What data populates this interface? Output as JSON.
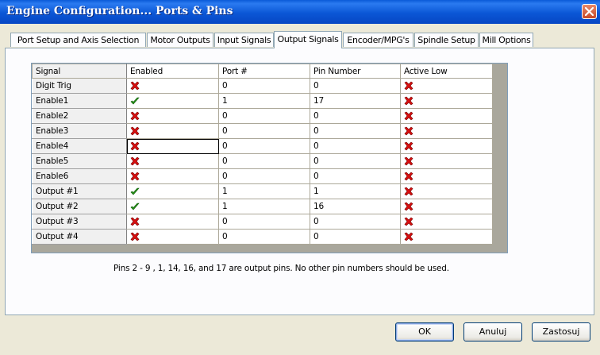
{
  "window": {
    "title": "Engine Configuration... Ports & Pins",
    "close_icon": "close-icon"
  },
  "tabs": [
    {
      "label": "Port Setup and Axis Selection",
      "active": false
    },
    {
      "label": "Motor Outputs",
      "active": false
    },
    {
      "label": "Input Signals",
      "active": false
    },
    {
      "label": "Output Signals",
      "active": true
    },
    {
      "label": "Encoder/MPG's",
      "active": false
    },
    {
      "label": "Spindle Setup",
      "active": false
    },
    {
      "label": "Mill Options",
      "active": false
    }
  ],
  "grid": {
    "columns": [
      "Signal",
      "Enabled",
      "Port #",
      "Pin Number",
      "Active Low"
    ],
    "rows": [
      {
        "signal": "Digit  Trig",
        "enabled": false,
        "port": "0",
        "pin": "0",
        "active_low": false
      },
      {
        "signal": "Enable1",
        "enabled": true,
        "port": "1",
        "pin": "17",
        "active_low": false
      },
      {
        "signal": "Enable2",
        "enabled": false,
        "port": "0",
        "pin": "0",
        "active_low": false
      },
      {
        "signal": "Enable3",
        "enabled": false,
        "port": "0",
        "pin": "0",
        "active_low": false
      },
      {
        "signal": "Enable4",
        "enabled": false,
        "port": "0",
        "pin": "0",
        "active_low": false
      },
      {
        "signal": "Enable5",
        "enabled": false,
        "port": "0",
        "pin": "0",
        "active_low": false
      },
      {
        "signal": "Enable6",
        "enabled": false,
        "port": "0",
        "pin": "0",
        "active_low": false
      },
      {
        "signal": "Output #1",
        "enabled": true,
        "port": "1",
        "pin": "1",
        "active_low": false
      },
      {
        "signal": "Output #2",
        "enabled": true,
        "port": "1",
        "pin": "16",
        "active_low": false
      },
      {
        "signal": "Output #3",
        "enabled": false,
        "port": "0",
        "pin": "0",
        "active_low": false
      },
      {
        "signal": "Output #4",
        "enabled": false,
        "port": "0",
        "pin": "0",
        "active_low": false
      }
    ],
    "selected_row": 4,
    "icons": {
      "true": "green-check-icon",
      "false": "red-x-icon"
    }
  },
  "note": "Pins 2 - 9 , 1, 14, 16, and 17 are output pins. No  other pin numbers should be used.",
  "buttons": {
    "ok": "OK",
    "cancel": "Anuluj",
    "apply": "Zastosuj"
  },
  "colors": {
    "titlebar": "#0b57d6",
    "check": "#2a9a1a",
    "cross": "#d81010"
  }
}
